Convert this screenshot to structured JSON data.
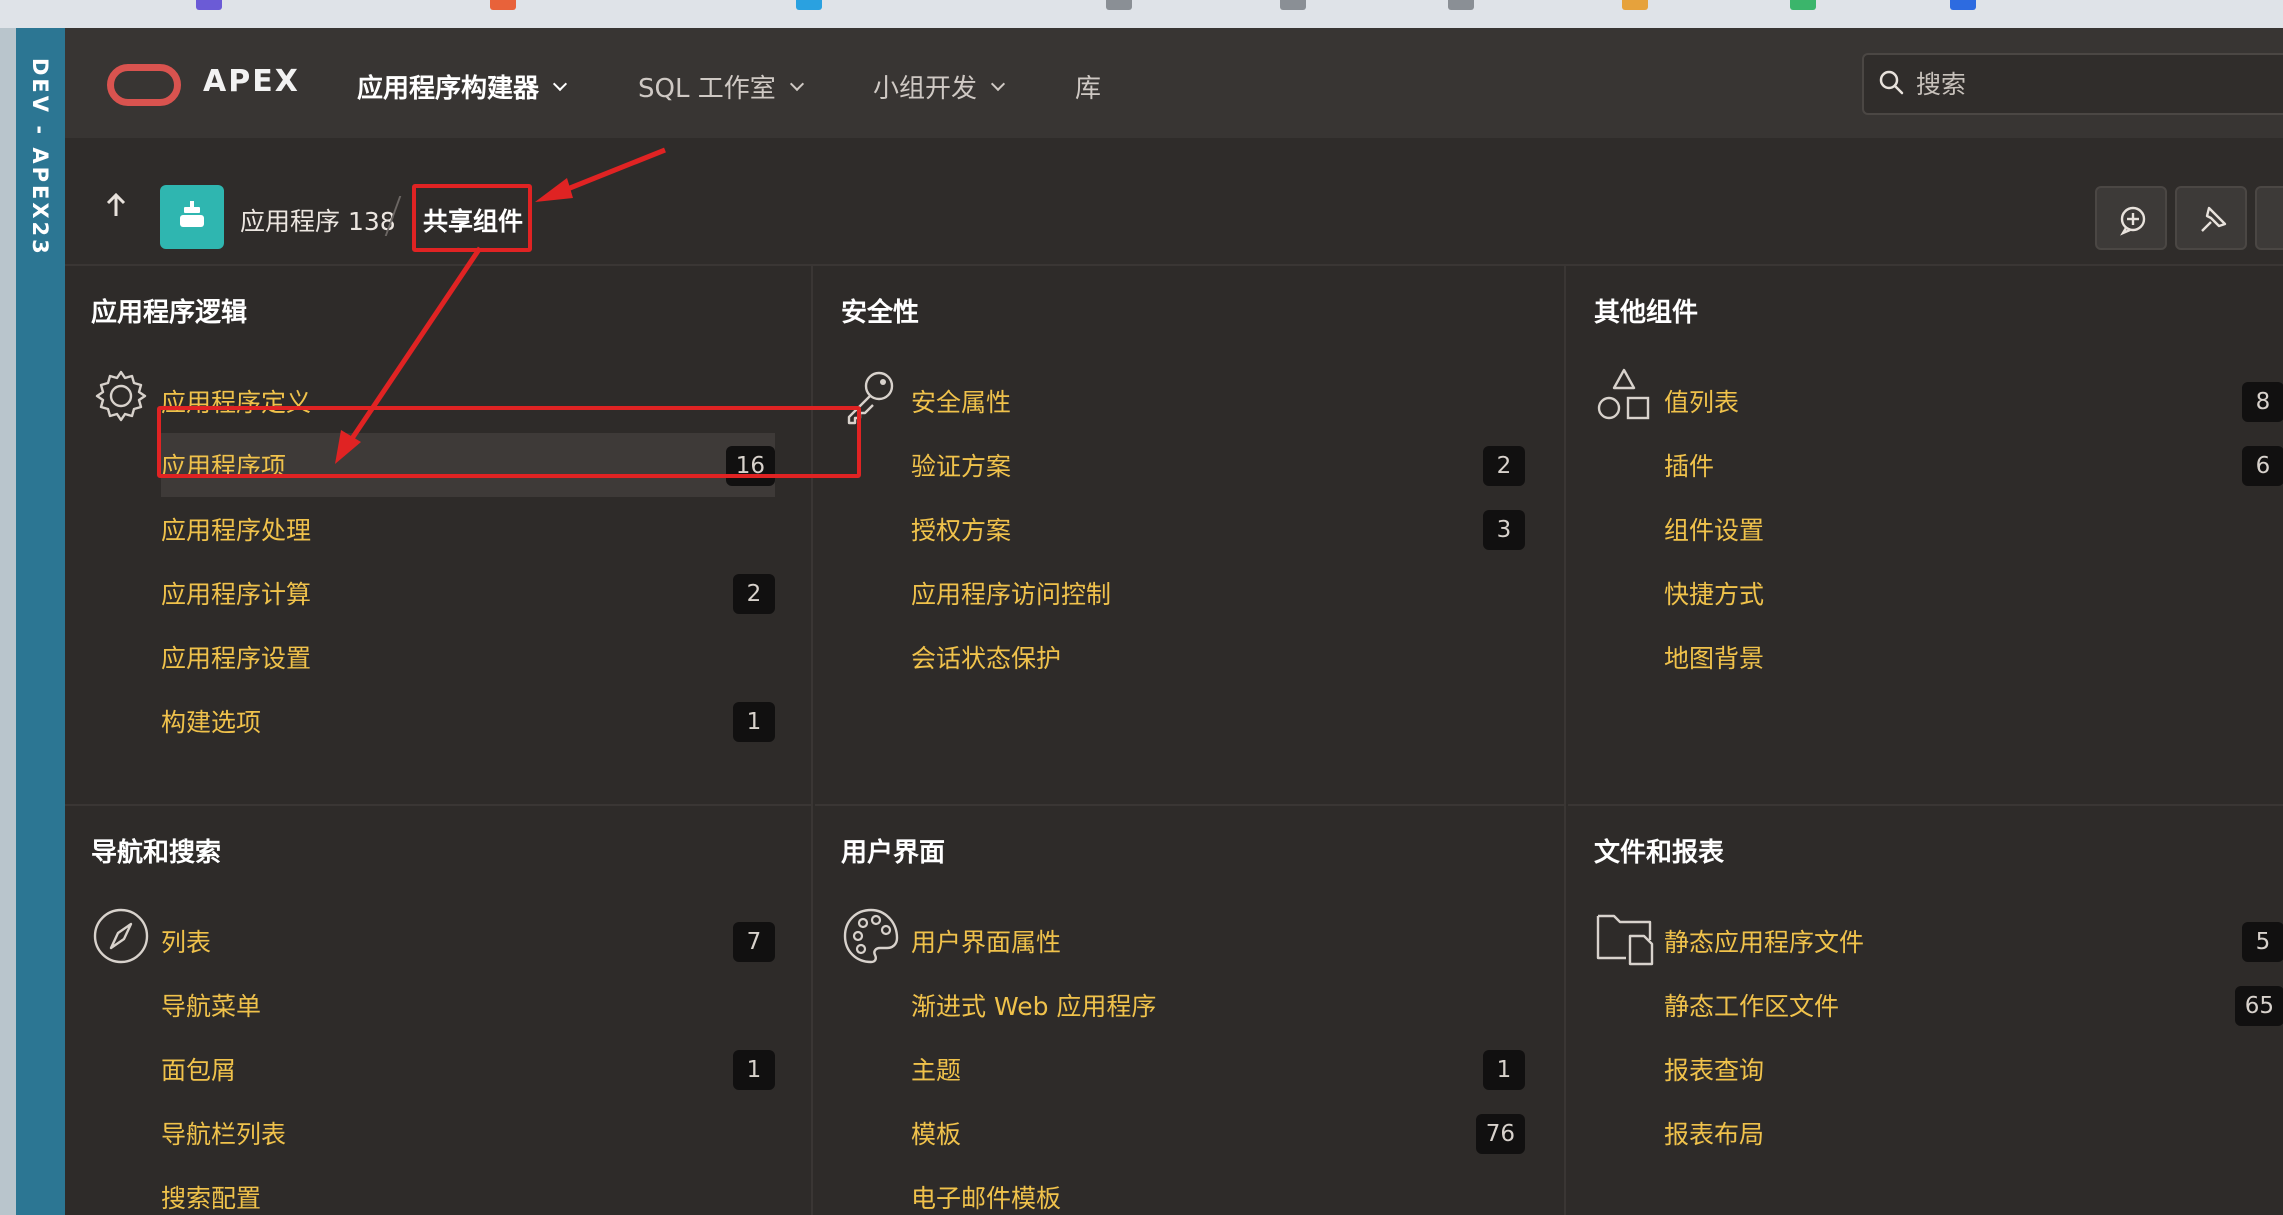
{
  "env_label": "DEV - APEX23",
  "header": {
    "brand": "APEX",
    "nav": [
      {
        "label": "应用程序构建器",
        "active": true,
        "dropdown": true
      },
      {
        "label": "SQL 工作室",
        "active": false,
        "dropdown": true
      },
      {
        "label": "小组开发",
        "active": false,
        "dropdown": true
      },
      {
        "label": "库",
        "active": false,
        "dropdown": false
      }
    ],
    "search_placeholder": "搜索"
  },
  "breadcrumb": {
    "app": "应用程序 138",
    "current": "共享组件"
  },
  "toolbar": {
    "icons": [
      "feedback-add-icon",
      "pin-icon"
    ]
  },
  "panels": [
    {
      "title": "应用程序逻辑",
      "icon": "gear-icon",
      "items": [
        {
          "label": "应用程序定义",
          "count": ""
        },
        {
          "label": "应用程序项",
          "count": "16"
        },
        {
          "label": "应用程序处理",
          "count": ""
        },
        {
          "label": "应用程序计算",
          "count": "2"
        },
        {
          "label": "应用程序设置",
          "count": ""
        },
        {
          "label": "构建选项",
          "count": "1"
        }
      ]
    },
    {
      "title": "安全性",
      "icon": "key-icon",
      "items": [
        {
          "label": "安全属性",
          "count": ""
        },
        {
          "label": "验证方案",
          "count": "2"
        },
        {
          "label": "授权方案",
          "count": "3"
        },
        {
          "label": "应用程序访问控制",
          "count": ""
        },
        {
          "label": "会话状态保护",
          "count": ""
        }
      ]
    },
    {
      "title": "其他组件",
      "icon": "shapes-icon",
      "items": [
        {
          "label": "值列表",
          "count": "8"
        },
        {
          "label": "插件",
          "count": "6"
        },
        {
          "label": "组件设置",
          "count": ""
        },
        {
          "label": "快捷方式",
          "count": ""
        },
        {
          "label": "地图背景",
          "count": ""
        }
      ]
    },
    {
      "title": "导航和搜索",
      "icon": "compass-icon",
      "items": [
        {
          "label": "列表",
          "count": "7"
        },
        {
          "label": "导航菜单",
          "count": ""
        },
        {
          "label": "面包屑",
          "count": "1"
        },
        {
          "label": "导航栏列表",
          "count": ""
        },
        {
          "label": "搜索配置",
          "count": ""
        }
      ]
    },
    {
      "title": "用户界面",
      "icon": "palette-icon",
      "items": [
        {
          "label": "用户界面属性",
          "count": ""
        },
        {
          "label": "渐进式 Web 应用程序",
          "count": ""
        },
        {
          "label": "主题",
          "count": "1"
        },
        {
          "label": "模板",
          "count": "76"
        },
        {
          "label": "电子邮件模板",
          "count": ""
        }
      ]
    },
    {
      "title": "文件和报表",
      "icon": "folder-file-icon",
      "items": [
        {
          "label": "静态应用程序文件",
          "count": "5"
        },
        {
          "label": "静态工作区文件",
          "count": "65"
        },
        {
          "label": "报表查询",
          "count": ""
        },
        {
          "label": "报表布局",
          "count": ""
        }
      ]
    }
  ],
  "colors": {
    "accent_link": "#f0c24b",
    "annotation": "#e02323",
    "brand_logo": "#d9534f",
    "app_icon": "#2fb6b0",
    "env_bar": "#2c7693"
  }
}
